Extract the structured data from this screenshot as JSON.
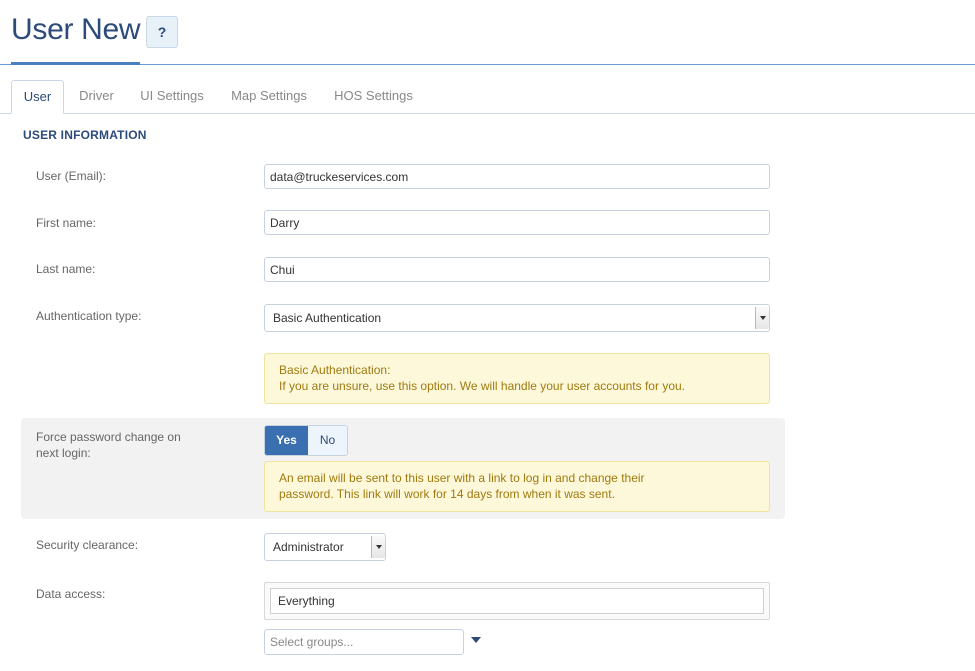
{
  "header": {
    "title": "User New",
    "help_label": "?"
  },
  "tabs": [
    {
      "label": "User",
      "active": true
    },
    {
      "label": "Driver",
      "active": false
    },
    {
      "label": "UI Settings",
      "active": false
    },
    {
      "label": "Map Settings",
      "active": false
    },
    {
      "label": "HOS Settings",
      "active": false
    }
  ],
  "form": {
    "section_title": "USER INFORMATION",
    "email": {
      "label": "User (Email):",
      "value": "data@truckeservices.com"
    },
    "first_name": {
      "label": "First name:",
      "value": "Darry"
    },
    "last_name": {
      "label": "Last name:",
      "value": "Chui"
    },
    "auth_type": {
      "label": "Authentication type:",
      "selected": "Basic Authentication",
      "note_title": "Basic Authentication:",
      "note_body": "If you are unsure, use this option. We will handle your user accounts for you."
    },
    "force_password": {
      "label_line1": "Force password change on",
      "label_line2": "next login:",
      "yes_label": "Yes",
      "no_label": "No",
      "selected": "Yes",
      "note_line1": "An email will be sent to this user with a link to log in and change their",
      "note_line2": "password. This link will work for 14 days from when it was sent."
    },
    "security_clearance": {
      "label": "Security clearance:",
      "selected": "Administrator"
    },
    "data_access": {
      "label": "Data access:",
      "value": "Everything",
      "groups_placeholder": "Select groups..."
    }
  },
  "colors": {
    "title": "#2c4a7a",
    "accent": "#3a6fb0",
    "note_bg": "#fdf8d9",
    "note_text": "#a07a10"
  }
}
